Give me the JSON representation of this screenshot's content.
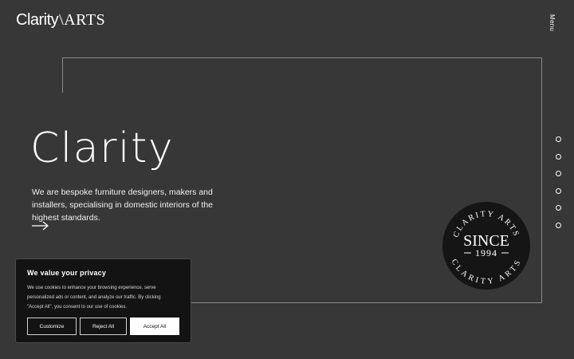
{
  "header": {
    "logo_part1": "Clarity",
    "logo_slash": "\\",
    "logo_part2": "ARTS",
    "menu_label": "Menu"
  },
  "hero": {
    "title": "Clarity",
    "description": "We are bespoke furniture designers, makers and installers, specialising in domestic interiors of the highest standards.",
    "arrow_icon": "arrow-right-icon"
  },
  "slide_nav": {
    "count": 6
  },
  "badge": {
    "top_text": "CLARITY ARTS",
    "since": "SINCE",
    "year": "1994",
    "bottom_text": "CLARITY ARTS"
  },
  "cookie_banner": {
    "title": "We value your privacy",
    "body": "We use cookies to enhance your browsing experience, serve personalized ads or content, and analyze our traffic. By clicking \"Accept All\", you consent to our use of cookies.",
    "customize_label": "Customize",
    "reject_label": "Reject All",
    "accept_label": "Accept All"
  },
  "colors": {
    "background": "#373737",
    "frame": "#8a8a8a",
    "badge": "#151515",
    "cookie_bg": "#131313",
    "text": "#ffffff"
  }
}
